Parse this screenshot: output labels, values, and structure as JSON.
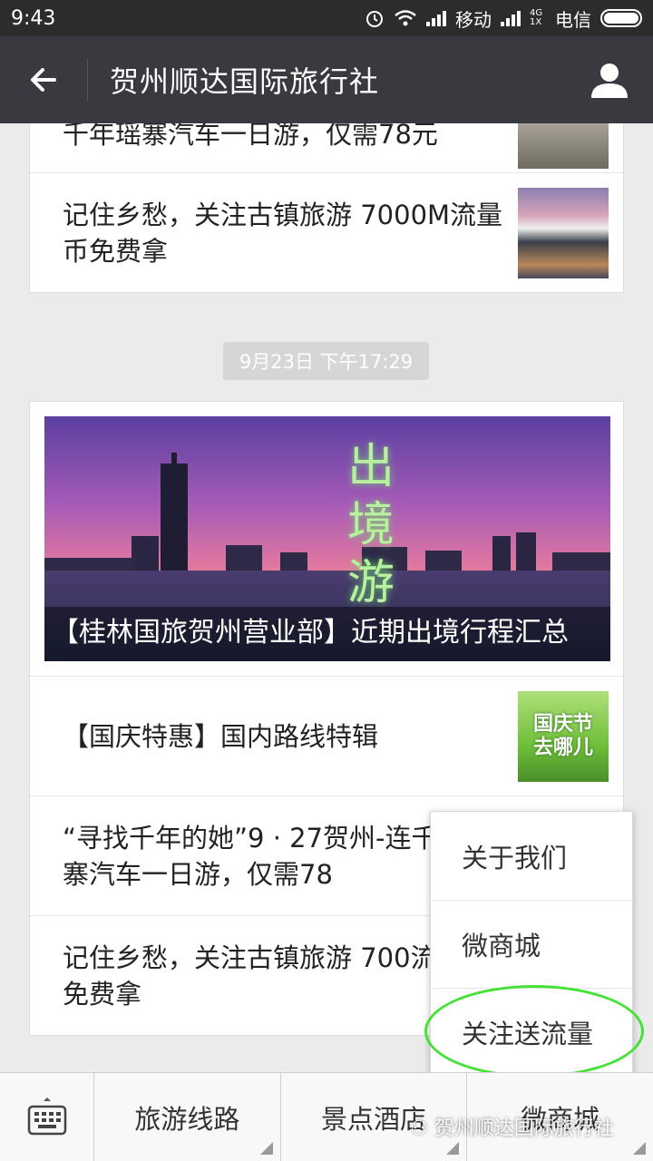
{
  "status_bar": {
    "time": "9:43",
    "carrier1": "移动",
    "network2": "4G 1X",
    "carrier2": "电信"
  },
  "title_bar": {
    "title": "贺州顺达国际旅行社",
    "back_icon": "arrow-left-icon",
    "profile_icon": "user-icon"
  },
  "messages": {
    "top_card_items": [
      {
        "text": "千年瑶寨汽车一日游，仅需78元"
      },
      {
        "text": "记住乡愁，关注古镇旅游 7000M流量币免费拿"
      }
    ],
    "timestamp": "9月23日 下午17:29",
    "bottom_card": {
      "hero_overlay": "出境游",
      "hero_caption": "【桂林国旅贺州营业部】近期出境行程汇总",
      "items": [
        {
          "text": "【国庆特惠】国内路线特辑",
          "thumb_text": "国庆节去哪儿"
        },
        {
          "text": "“寻找千年的她”9 · 27贺州-连千年瑶寨汽车一日游，仅需78"
        },
        {
          "text": "记住乡愁，关注古镇旅游 700流量币免费拿"
        }
      ]
    }
  },
  "popup_menu": {
    "items": [
      "关于我们",
      "微商城",
      "关注送流量"
    ]
  },
  "bottom_menu": {
    "keyboard_icon": "keyboard-icon",
    "items": [
      "旅游线路",
      "景点酒店",
      "微商城"
    ]
  },
  "watermark": "贺州顺达国际旅行社",
  "colors": {
    "title_bar_bg": "#393a3f",
    "status_bar_bg": "#2c2c2c",
    "highlight": "#44e236"
  }
}
